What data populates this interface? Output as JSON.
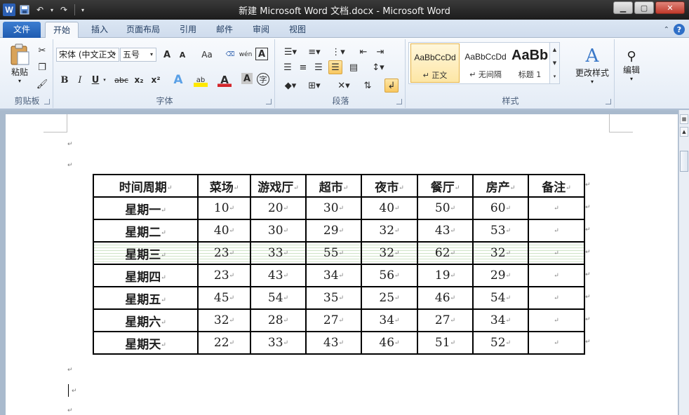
{
  "window": {
    "title": "新建 Microsoft Word 文档.docx - Microsoft Word",
    "logo": "W",
    "help": "?"
  },
  "tabs": [
    {
      "label": "文件",
      "file": true
    },
    {
      "label": "开始",
      "active": true
    },
    {
      "label": "插入"
    },
    {
      "label": "页面布局"
    },
    {
      "label": "引用"
    },
    {
      "label": "邮件"
    },
    {
      "label": "审阅"
    },
    {
      "label": "视图"
    }
  ],
  "ribbon": {
    "clipboard": {
      "label": "剪贴板",
      "paste_label": "粘贴"
    },
    "font": {
      "label": "字体",
      "font_name": "宋体 (中文正文",
      "font_size": "五号",
      "grow": "A",
      "shrink": "A",
      "case": "Aa",
      "pinyin": "wén",
      "border_char": "A",
      "bold": "B",
      "italic": "I",
      "underline": "U",
      "strike": "abc",
      "sub": "x₂",
      "sup": "x²",
      "effects": "A",
      "highlight": "ab",
      "color": "A",
      "shade": "A",
      "enclose": "字"
    },
    "paragraph": {
      "label": "段落"
    },
    "styles": {
      "label": "样式",
      "items": [
        {
          "preview": "AaBbCcDd",
          "name": "↵ 正文",
          "selected": true
        },
        {
          "preview": "AaBbCcDd",
          "name": "↵ 无间隔"
        },
        {
          "preview": "AaBb",
          "name": "标题 1",
          "big": true
        }
      ],
      "change_label": "更改样式"
    },
    "editing": {
      "label": "编辑"
    }
  },
  "table": {
    "headers": [
      "时间周期",
      "菜场",
      "游戏厅",
      "超市",
      "夜市",
      "餐厅",
      "房产",
      "备注"
    ],
    "rows": [
      {
        "day": "星期一",
        "values": [
          "10",
          "20",
          "30",
          "40",
          "50",
          "60",
          ""
        ]
      },
      {
        "day": "星期二",
        "values": [
          "40",
          "30",
          "29",
          "32",
          "43",
          "53",
          ""
        ]
      },
      {
        "day": "星期三",
        "values": [
          "23",
          "33",
          "55",
          "32",
          "62",
          "32",
          ""
        ],
        "highlight": true
      },
      {
        "day": "星期四",
        "values": [
          "23",
          "43",
          "34",
          "56",
          "19",
          "29",
          ""
        ]
      },
      {
        "day": "星期五",
        "values": [
          "45",
          "54",
          "35",
          "25",
          "46",
          "54",
          ""
        ]
      },
      {
        "day": "星期六",
        "values": [
          "32",
          "28",
          "27",
          "34",
          "27",
          "34",
          ""
        ]
      },
      {
        "day": "星期天",
        "values": [
          "22",
          "33",
          "43",
          "46",
          "51",
          "52",
          ""
        ]
      }
    ]
  },
  "marks": {
    "para": "↵"
  }
}
